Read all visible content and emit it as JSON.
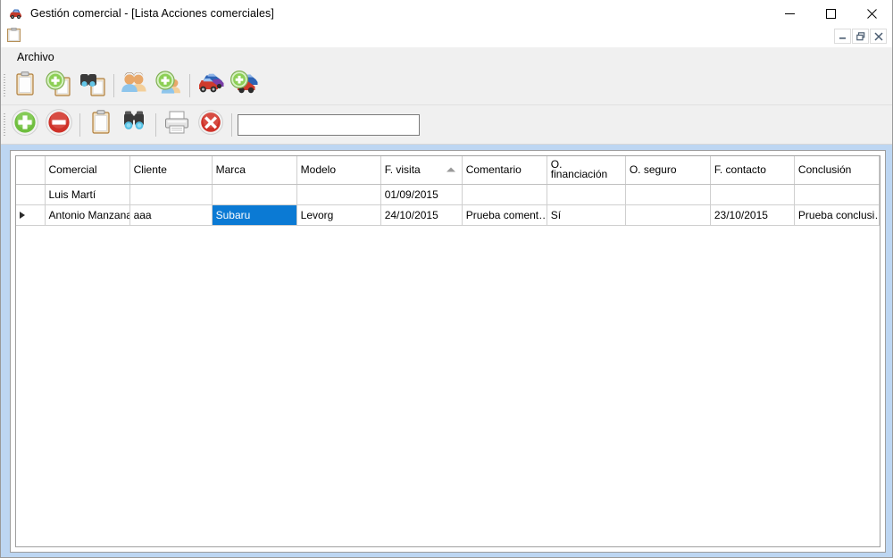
{
  "window": {
    "title": "Gestión comercial - [Lista Acciones comerciales]",
    "app_icon": "car-icon",
    "minimize_label": "Minimizar",
    "maximize_label": "Maximizar",
    "close_label": "Cerrar"
  },
  "mdi": {
    "doc_icon": "clipboard-icon",
    "restore_label": "Restaurar",
    "minimize_label": "Minimizar",
    "close_label": "Cerrar"
  },
  "menubar": {
    "items": [
      {
        "label": "Archivo"
      }
    ]
  },
  "toolbar_main": {
    "buttons": [
      {
        "icon": "clipboard-icon",
        "label": "Lista acciones comerciales"
      },
      {
        "icon": "clipboard-add-icon",
        "label": "Nueva acción comercial"
      },
      {
        "icon": "clipboard-search-icon",
        "label": "Buscar acción comercial"
      },
      {
        "icon": "people-icon",
        "label": "Clientes"
      },
      {
        "icon": "people-add-icon",
        "label": "Nuevo cliente"
      },
      {
        "icon": "cars-icon",
        "label": "Vehículos"
      },
      {
        "icon": "car-add-icon",
        "label": "Nuevo vehículo"
      }
    ]
  },
  "toolbar_actions": {
    "buttons": [
      {
        "icon": "add-circle-icon",
        "label": "Añadir"
      },
      {
        "icon": "remove-circle-icon",
        "label": "Eliminar"
      },
      {
        "icon": "clipboard-icon",
        "label": "Detalle"
      },
      {
        "icon": "binoculars-icon",
        "label": "Buscar"
      },
      {
        "icon": "printer-icon",
        "label": "Imprimir"
      },
      {
        "icon": "cancel-circle-icon",
        "label": "Cancelar"
      }
    ],
    "search": {
      "value": "",
      "placeholder": ""
    }
  },
  "grid": {
    "columns": [
      {
        "key": "indicator",
        "label": ""
      },
      {
        "key": "comercial",
        "label": "Comercial"
      },
      {
        "key": "cliente",
        "label": "Cliente"
      },
      {
        "key": "marca",
        "label": "Marca"
      },
      {
        "key": "modelo",
        "label": "Modelo"
      },
      {
        "key": "f_visita",
        "label": "F. visita",
        "sort": "asc"
      },
      {
        "key": "comentario",
        "label": "Comentario"
      },
      {
        "key": "o_financiacion",
        "label": "O. financiación"
      },
      {
        "key": "o_seguro",
        "label": "O. seguro"
      },
      {
        "key": "f_contacto",
        "label": "F. contacto"
      },
      {
        "key": "conclusion",
        "label": "Conclusión"
      }
    ],
    "rows": [
      {
        "current": false,
        "indicator": "",
        "comercial": "Luis Martí",
        "cliente": "",
        "marca": "",
        "modelo": "",
        "f_visita": "01/09/2015",
        "comentario": "",
        "o_financiacion": "",
        "o_seguro": "",
        "f_contacto": "",
        "conclusion": ""
      },
      {
        "current": true,
        "indicator": "▶",
        "comercial": "Antonio Manzana",
        "cliente": "aaa",
        "marca": "Subaru",
        "modelo": "Levorg",
        "f_visita": "24/10/2015",
        "comentario": "Prueba coment…",
        "o_financiacion": "Sí",
        "o_seguro": "",
        "f_contacto": "23/10/2015",
        "conclusion": "Prueba conclusi…"
      }
    ],
    "selected_cell": {
      "row": 1,
      "column": "marca"
    }
  },
  "colors": {
    "selection": "#0b7ad4",
    "mdi_background": "#bdd6f2",
    "toolbar_background": "#f0f0f0",
    "grid_line": "#cfcfcf",
    "window_background": "#ffffff"
  }
}
